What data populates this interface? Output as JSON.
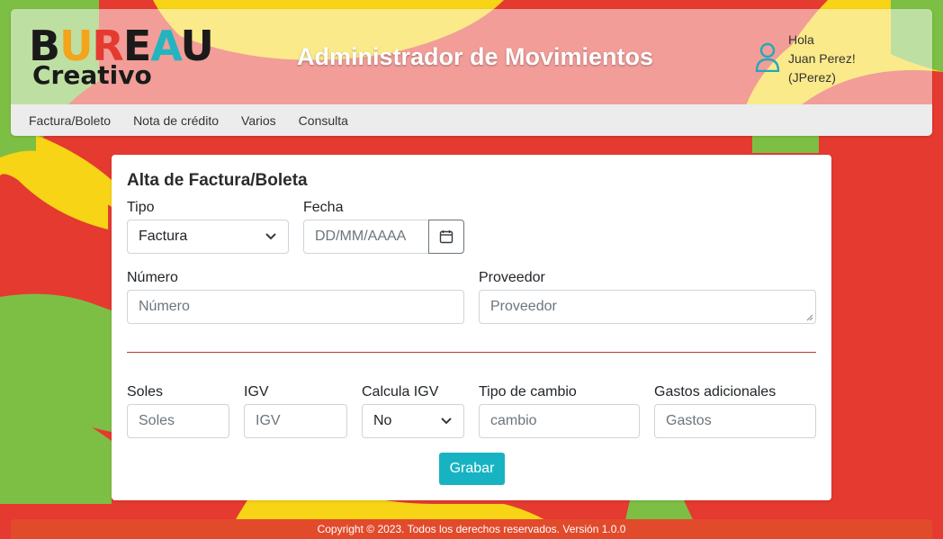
{
  "colors": {
    "background_red": "#e53a30",
    "accent_green": "#7dbf45",
    "accent_yellow": "#f7d415",
    "button_teal": "#17b3c3",
    "divider_red": "#c0392b",
    "footer_orange": "#e24a2c"
  },
  "logo": {
    "line1_letters": [
      "B",
      "U",
      "R",
      "E",
      "A",
      "U"
    ],
    "line2": "Creativo"
  },
  "header": {
    "title": "Administrador de Movimientos",
    "user": {
      "icon": "user-icon",
      "greeting": "Hola",
      "name": "Juan Perez!",
      "username": "(JPerez)"
    }
  },
  "nav": {
    "items": [
      "Factura/Boleto",
      "Nota de crédito",
      "Varios",
      "Consulta"
    ]
  },
  "form": {
    "title": "Alta de Factura/Boleta",
    "tipo": {
      "label": "Tipo",
      "value": "Factura"
    },
    "fecha": {
      "label": "Fecha",
      "placeholder": "DD/MM/AAAA",
      "icon": "calendar-icon"
    },
    "numero": {
      "label": "Número",
      "placeholder": "Número"
    },
    "proveedor": {
      "label": "Proveedor",
      "placeholder": "Proveedor"
    },
    "soles": {
      "label": "Soles",
      "placeholder": "Soles"
    },
    "igv": {
      "label": "IGV",
      "placeholder": "IGV"
    },
    "calcula_igv": {
      "label": "Calcula IGV",
      "value": "No"
    },
    "tipo_cambio": {
      "label": "Tipo de cambio",
      "placeholder": "cambio"
    },
    "gastos": {
      "label": "Gastos adicionales",
      "placeholder": "Gastos"
    },
    "save_label": "Grabar"
  },
  "footer": {
    "text": "Copyright © 2023. Todos los derechos reservados. Versión 1.0.0"
  }
}
